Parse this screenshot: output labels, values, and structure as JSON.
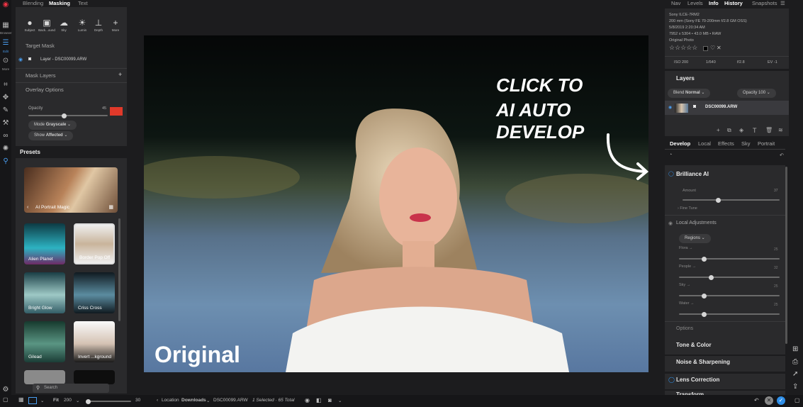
{
  "left_rail": {
    "items": [
      {
        "label": "Browser",
        "icon": "grid-icon"
      },
      {
        "label": "Edit",
        "icon": "sliders-icon"
      },
      {
        "label": "More",
        "icon": "more-icon"
      }
    ],
    "tool_icons": [
      "crop-icon",
      "transform-icon",
      "brush-icon",
      "clone-icon",
      "healing-icon",
      "color-icon",
      "search-icon"
    ]
  },
  "mask_tabs": {
    "blending": "Blending",
    "masking": "Masking",
    "text": "Text"
  },
  "mask_tools": [
    {
      "label": "Subject",
      "icon": "person-icon"
    },
    {
      "label": "Back...ound",
      "icon": "portrait-icon"
    },
    {
      "label": "Sky",
      "icon": "cloud-icon"
    },
    {
      "label": "Lumin",
      "icon": "sun-icon"
    },
    {
      "label": "Depth",
      "icon": "depth-icon"
    },
    {
      "label": "More",
      "icon": "plus-icon"
    }
  ],
  "mask": {
    "target_mask": "Target Mask",
    "layer_name": "Layer - DSC00099.ARW",
    "mask_layers": "Mask Layers",
    "overlay_options": "Overlay Options",
    "opacity_label": "Opacity",
    "opacity_value": "45",
    "opacity_fraction": 0.45,
    "overlay_color": "#e0392a",
    "mode_label": "Mode",
    "mode_value": "Grayscale",
    "show_label": "Show",
    "show_value": "Affected"
  },
  "presets": {
    "title": "Presets",
    "featured": "AI Portrait Magic",
    "items": [
      "Alien Planet",
      "Border Pop Off",
      "Bright Glow",
      "Criss Cross",
      "Gilead",
      "Invert ...kground"
    ],
    "search_placeholder": "Search"
  },
  "photo": {
    "overlay_text": "Original",
    "callout_line1": "CLICK TO",
    "callout_line2": "AI AUTO DEVELOP"
  },
  "right_tabs": {
    "nav": "Nav",
    "levels": "Levels",
    "info": "Info",
    "history": "History",
    "snapshots": "Snapshots"
  },
  "info": {
    "camera": "Sony ILCE-7RM2",
    "lens": "200 mm (Sony FE 70-200mm f/2.8 GM OSS)",
    "date": "5/8/2019 2:20:34 AM",
    "dims": "7952 x 5304 • 43.0 MB • RAW",
    "type": "Original Photo",
    "stars": "☆☆☆☆☆",
    "iso": "ISO 200",
    "shutter": "1/640",
    "aperture": "f/2.8",
    "ev": "EV -1"
  },
  "layers": {
    "title": "Layers",
    "blend_label": "Blend",
    "blend_value": "Normal",
    "opacity_label": "Opacity",
    "opacity_value": "100",
    "layer_name": "DSC00099.ARW"
  },
  "develop_tabs": {
    "develop": "Develop",
    "local": "Local",
    "effects": "Effects",
    "sky": "Sky",
    "portrait": "Portrait"
  },
  "brilliance": {
    "title": "Brilliance AI",
    "amount_label": "Amount",
    "amount_value": "37",
    "amount_fraction": 0.37,
    "fine_tune": "Fine Tune",
    "local_adjustments": "Local Adjustments",
    "regions": "Regions",
    "sliders": [
      {
        "label": "Flora →",
        "value": "25",
        "fraction": 0.25
      },
      {
        "label": "People →",
        "value": "32",
        "fraction": 0.32
      },
      {
        "label": "Sky →",
        "value": "25",
        "fraction": 0.25
      },
      {
        "label": "Water →",
        "value": "25",
        "fraction": 0.25
      }
    ],
    "options": "Options"
  },
  "sections": [
    "Tone & Color",
    "Noise & Sharpening",
    "Lens Correction",
    "Transform"
  ],
  "bottom": {
    "fit": "Fit",
    "zoom": "200",
    "thumb_size": "30",
    "location_prefix": "Location",
    "location": "Downloads",
    "file": "DSC00099.ARW",
    "selection": "1 Selected · 65 Total"
  },
  "colors": {
    "accent": "#2f8fe8",
    "overlay": "#e0392a"
  }
}
